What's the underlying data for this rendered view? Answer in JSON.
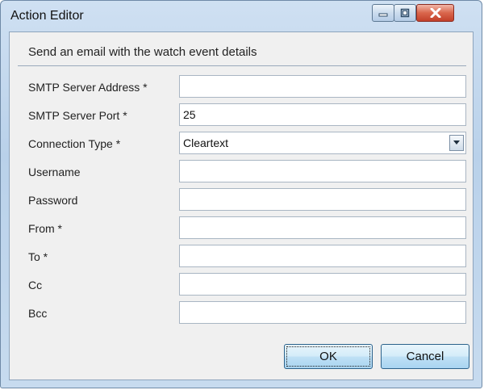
{
  "window": {
    "title": "Action Editor"
  },
  "header": "Send an email with the watch event details",
  "fields": [
    {
      "label": "SMTP Server Address *",
      "value": ""
    },
    {
      "label": "SMTP Server Port *",
      "value": "25"
    },
    {
      "label": "Connection Type *",
      "value": "Cleartext"
    },
    {
      "label": "Username",
      "value": ""
    },
    {
      "label": "Password",
      "value": ""
    },
    {
      "label": "From *",
      "value": ""
    },
    {
      "label": "To *",
      "value": ""
    },
    {
      "label": "Cc",
      "value": ""
    },
    {
      "label": "Bcc",
      "value": ""
    }
  ],
  "buttons": {
    "ok": "OK",
    "cancel": "Cancel"
  },
  "icons": {
    "minimize": "minimize-icon",
    "maximize": "maximize-icon",
    "close": "close-icon",
    "dropdown": "chevron-down-icon"
  }
}
